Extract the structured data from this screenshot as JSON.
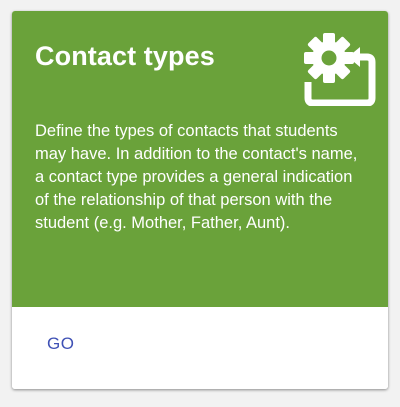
{
  "card": {
    "title": "Contact types",
    "description": "Define the types of contacts that students may have. In addition to the contact's name, a contact type provides a general indication of the relationship of that person with the student (e.g. Mother, Father, Aunt).",
    "icon": "settings-applications-icon",
    "action_label": "GO"
  },
  "colors": {
    "header_bg": "#6aa23a",
    "text_on_header": "#ffffff",
    "action_text": "#3f51b5"
  }
}
